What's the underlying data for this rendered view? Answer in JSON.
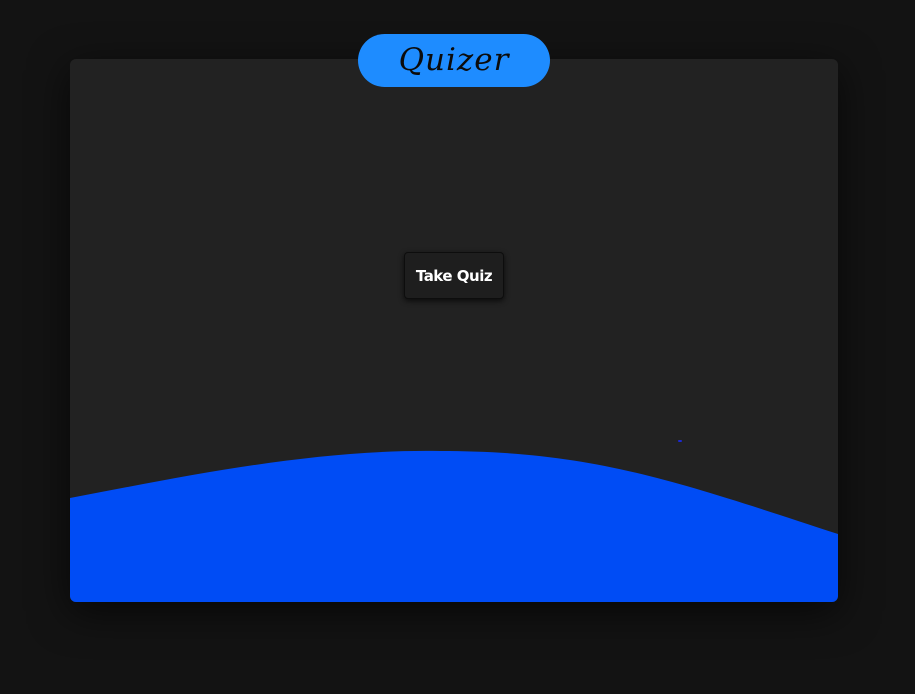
{
  "app": {
    "title": "Quizer"
  },
  "actions": {
    "take_quiz_label": "Take Quiz"
  },
  "colors": {
    "page_background": "#131313",
    "card_background": "#222222",
    "title_pill": "#1e8cff",
    "wave": "#004cf5",
    "button_background": "#1e1e1e",
    "button_text": "#ffffff"
  }
}
